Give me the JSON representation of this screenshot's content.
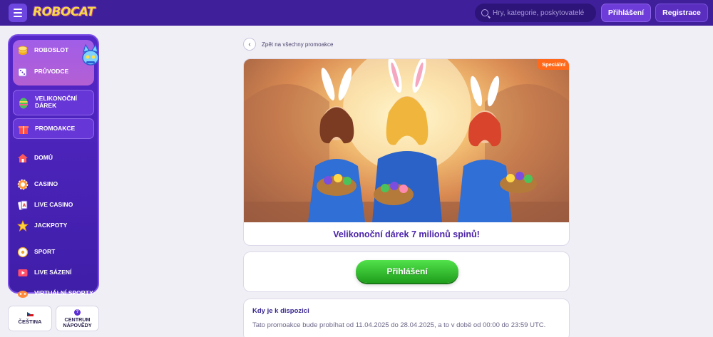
{
  "header": {
    "logo": "ROBOCAT",
    "search_placeholder": "Hry, kategorie, poskytovatelé",
    "login_label": "Přihlášení",
    "register_label": "Registrace"
  },
  "sidebar": {
    "promo_items": [
      {
        "label": "ROBOSLOT",
        "icon": "coin-stack-icon"
      },
      {
        "label": "PRŮVODCE",
        "icon": "dice-icon"
      }
    ],
    "boxed_items": [
      {
        "label": "VELIKONOČNÍ DÁREK",
        "icon": "easter-egg-icon"
      },
      {
        "label": "PROMOAKCE",
        "icon": "gift-icon"
      }
    ],
    "nav_items": [
      {
        "label": "DOMŮ",
        "icon": "home-icon"
      },
      {
        "label": "CASINO",
        "icon": "casino-chip-icon"
      },
      {
        "label": "LIVE CASINO",
        "icon": "playing-cards-icon"
      },
      {
        "label": "JACKPOTY",
        "icon": "jackpot-icon"
      },
      {
        "label": "SPORT",
        "icon": "ball-icon"
      },
      {
        "label": "LIVE SÁZENÍ",
        "icon": "live-betting-icon"
      },
      {
        "label": "VIRTUÁLNÍ SPORTY",
        "icon": "virtual-sports-icon"
      }
    ],
    "language_label": "ČEŠTINA",
    "help_label": "CENTRUM NÁPOVĚDY"
  },
  "main": {
    "back_label": "Zpět na všechny promoakce",
    "badge": "Speciální",
    "promo_title": "Velikonoční dárek 7 milionů spinů!",
    "cta_label": "Přihlášení",
    "availability_title": "Kdy je k dispozici",
    "availability_text": "Tato promoakce bude probíhat od 11.04.2025 do 28.04.2025, a to v době od 00:00 do 23:59 UTC."
  },
  "colors": {
    "header_bg": "#3f1f9a",
    "sidebar_bg": "#4a22b8",
    "accent_purple": "#6e3cd9",
    "cta_green": "#2fbf2a",
    "badge_orange": "#ff6a1a",
    "title_purple": "#4b23a8"
  }
}
